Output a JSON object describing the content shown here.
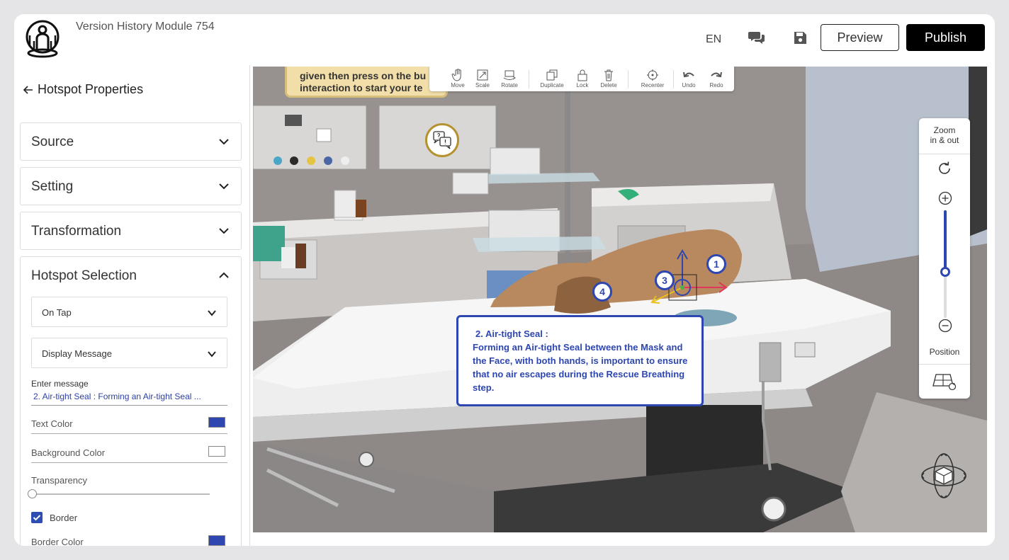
{
  "header": {
    "title": "Version History Module 754",
    "language": "EN",
    "preview_label": "Preview",
    "publish_label": "Publish"
  },
  "sidebar": {
    "back_label": "Hotspot Properties",
    "sections": {
      "source": "Source",
      "setting": "Setting",
      "transformation": "Transformation",
      "hotspot_selection": "Hotspot Selection"
    },
    "hotspot_selection": {
      "trigger": "On Tap",
      "action": "Display Message",
      "message_label": "Enter message",
      "message_value": "2. Air-tight Seal : Forming an Air-tight Seal ...",
      "text_color_label": "Text Color",
      "text_color": "#2d46b0",
      "background_color_label": "Background Color",
      "background_color": "#ffffff",
      "transparency_label": "Transparency",
      "transparency": 0,
      "border_label": "Border",
      "border_checked": true,
      "border_color_label": "Border Color",
      "border_color": "#2d46b0"
    }
  },
  "viewport": {
    "instruction_line1": "given then press on the bu",
    "instruction_line2": "interaction to start your te",
    "toolbar": {
      "move": "Move",
      "scale": "Scale",
      "rotate": "Rotate",
      "duplicate": "Duplicate",
      "lock": "Lock",
      "delete": "Delete",
      "recenter": "Recenter",
      "undo": "Undo",
      "redo": "Redo"
    },
    "hotspots": [
      "1",
      "3",
      "4"
    ],
    "message": {
      "title": "2. Air-tight Seal :",
      "text": "Forming an Air-tight Seal between the Mask and the Face, with both hands, is important to ensure that no air escapes during the Rescue Breathing step."
    },
    "zoom": {
      "label_line1": "Zoom",
      "label_line2": "in & out",
      "position_label": "Position",
      "level": 0.57
    }
  }
}
